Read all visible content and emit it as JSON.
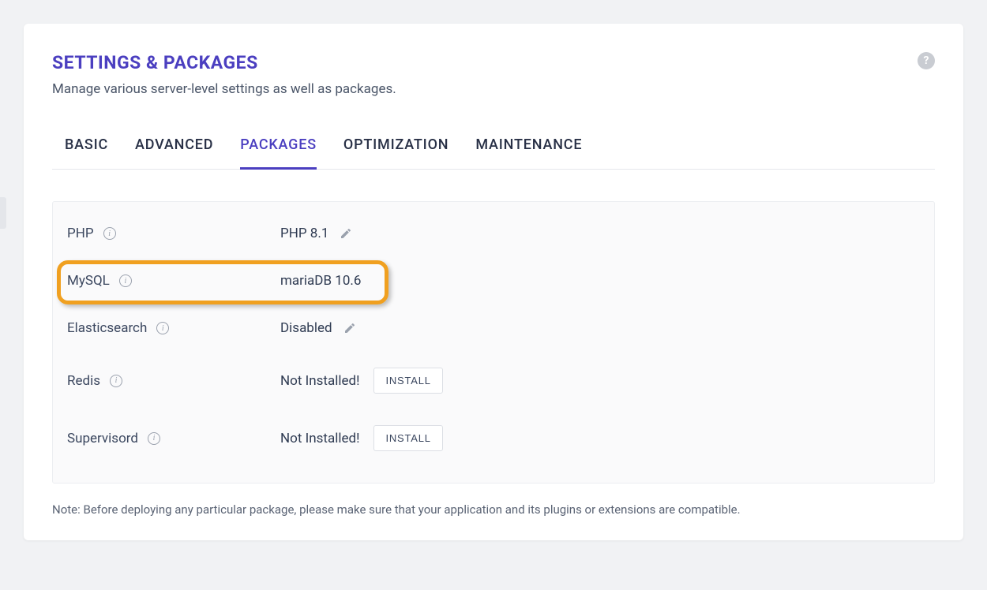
{
  "header": {
    "title": "SETTINGS & PACKAGES",
    "subtitle": "Manage various server-level settings as well as packages.",
    "help_glyph": "?"
  },
  "tabs": {
    "basic": "BASIC",
    "advanced": "ADVANCED",
    "packages": "PACKAGES",
    "optimization": "OPTIMIZATION",
    "maintenance": "MAINTENANCE"
  },
  "packages": {
    "php": {
      "label": "PHP",
      "value": "PHP 8.1"
    },
    "mysql": {
      "label": "MySQL",
      "value": "mariaDB 10.6"
    },
    "elasticsearch": {
      "label": "Elasticsearch",
      "value": "Disabled"
    },
    "redis": {
      "label": "Redis",
      "value": "Not Installed!",
      "install_label": "INSTALL"
    },
    "supervisord": {
      "label": "Supervisord",
      "value": "Not Installed!",
      "install_label": "INSTALL"
    }
  },
  "note": "Note: Before deploying any particular package, please make sure that your application and its plugins or extensions are compatible.",
  "info_glyph": "i"
}
